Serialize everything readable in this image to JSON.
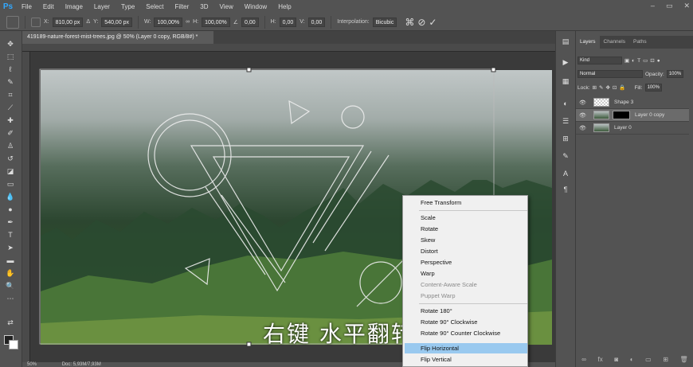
{
  "menubar": {
    "logo": "Ps",
    "items": [
      "File",
      "Edit",
      "Image",
      "Layer",
      "Type",
      "Select",
      "Filter",
      "3D",
      "View",
      "Window",
      "Help"
    ]
  },
  "options": {
    "x_label": "X:",
    "x_value": "810,00 px",
    "y_label": "Y:",
    "y_value": "540,00 px",
    "w_label": "W:",
    "w_value": "100,00%",
    "h_label": "H:",
    "h_value": "100,00%",
    "angle_value": "0,00",
    "hskew_label": "H:",
    "hskew_value": "0,00",
    "vskew_label": "V:",
    "vskew_value": "0,00",
    "interp_label": "Interpolation:",
    "interp_value": "Bicubic"
  },
  "document": {
    "tab_title": "419189-nature-forest-mist-trees.jpg @ 50% (Layer 0 copy, RGB/8#) *",
    "zoom": "50%",
    "doc_info": "Doc: 5,93M/7,93M"
  },
  "context_menu": {
    "items": [
      {
        "label": "Free Transform",
        "enabled": true
      },
      {
        "label": "Scale",
        "enabled": true
      },
      {
        "label": "Rotate",
        "enabled": true
      },
      {
        "label": "Skew",
        "enabled": true
      },
      {
        "label": "Distort",
        "enabled": true
      },
      {
        "label": "Perspective",
        "enabled": true
      },
      {
        "label": "Warp",
        "enabled": true
      },
      {
        "label": "Content-Aware Scale",
        "enabled": false
      },
      {
        "label": "Puppet Warp",
        "enabled": false
      },
      {
        "label": "Rotate 180°",
        "enabled": true
      },
      {
        "label": "Rotate 90° Clockwise",
        "enabled": true
      },
      {
        "label": "Rotate 90° Counter Clockwise",
        "enabled": true
      },
      {
        "label": "Flip Horizontal",
        "enabled": true,
        "highlighted": true
      },
      {
        "label": "Flip Vertical",
        "enabled": true
      }
    ]
  },
  "subtitle": "右键 水平翻转",
  "layers_panel": {
    "tabs": [
      "Layers",
      "Channels",
      "Paths"
    ],
    "active_tab": "Layers",
    "kind_placeholder": "Kind",
    "blend_mode": "Normal",
    "opacity_label": "Opacity:",
    "opacity_value": "100%",
    "lock_label": "Lock:",
    "fill_label": "Fill:",
    "fill_value": "100%",
    "layers": [
      {
        "name": "Shape 3",
        "selected": false
      },
      {
        "name": "Layer 0 copy",
        "selected": true
      },
      {
        "name": "Layer 0",
        "selected": false
      }
    ]
  },
  "colors": {
    "accent": "#31a8ff",
    "menu_highlight": "#99c9ef",
    "panel_bg": "#535353"
  }
}
